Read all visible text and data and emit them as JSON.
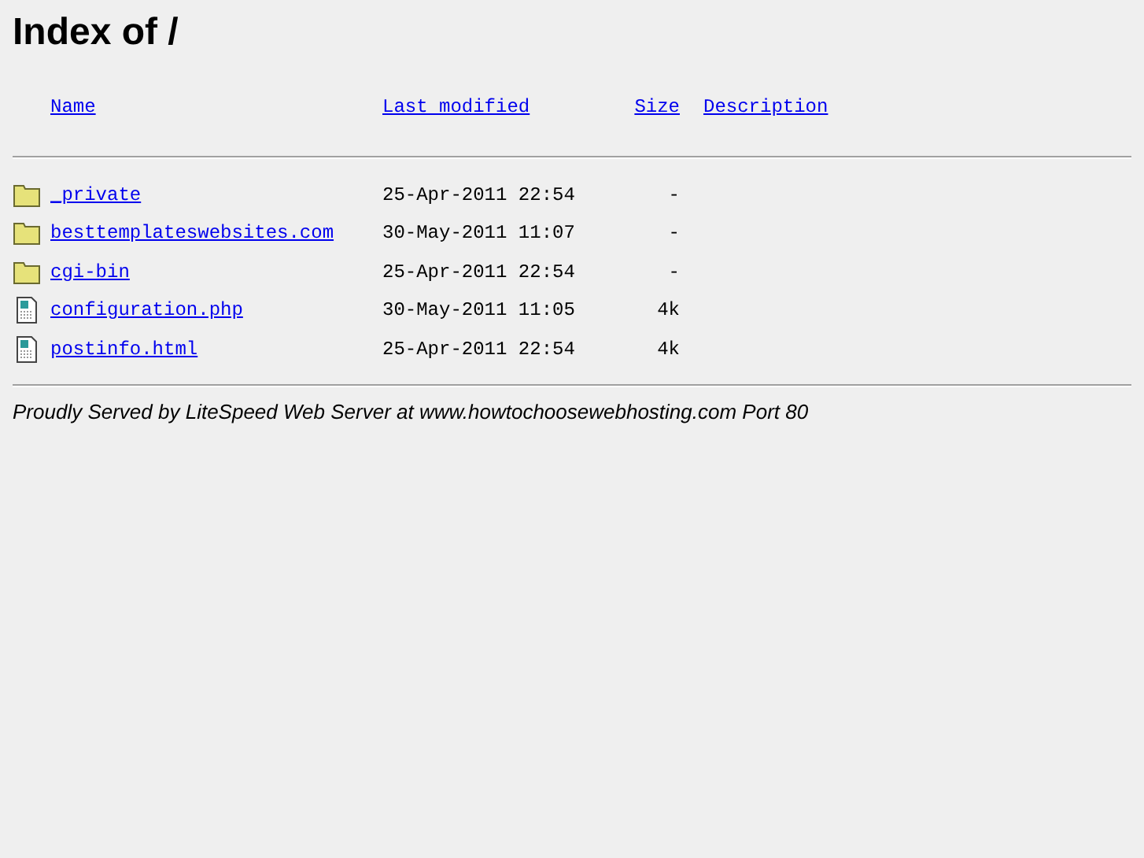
{
  "title": "Index of /",
  "columns": [
    "Name",
    "Last modified",
    "Size",
    "Description"
  ],
  "rows": [
    {
      "kind": "folder",
      "name": "_private",
      "modified": "25-Apr-2011 22:54",
      "size": "-"
    },
    {
      "kind": "folder",
      "name": "besttemplateswebsites.com",
      "modified": "30-May-2011 11:07",
      "size": "-"
    },
    {
      "kind": "folder",
      "name": "cgi-bin",
      "modified": "25-Apr-2011 22:54",
      "size": "-"
    },
    {
      "kind": "file",
      "name": "configuration.php",
      "modified": "30-May-2011 11:05",
      "size": "4k"
    },
    {
      "kind": "file",
      "name": "postinfo.html",
      "modified": "25-Apr-2011 22:54",
      "size": "4k"
    }
  ],
  "footer": "Proudly Served by LiteSpeed Web Server at www.howtochoosewebhosting.com Port 80"
}
